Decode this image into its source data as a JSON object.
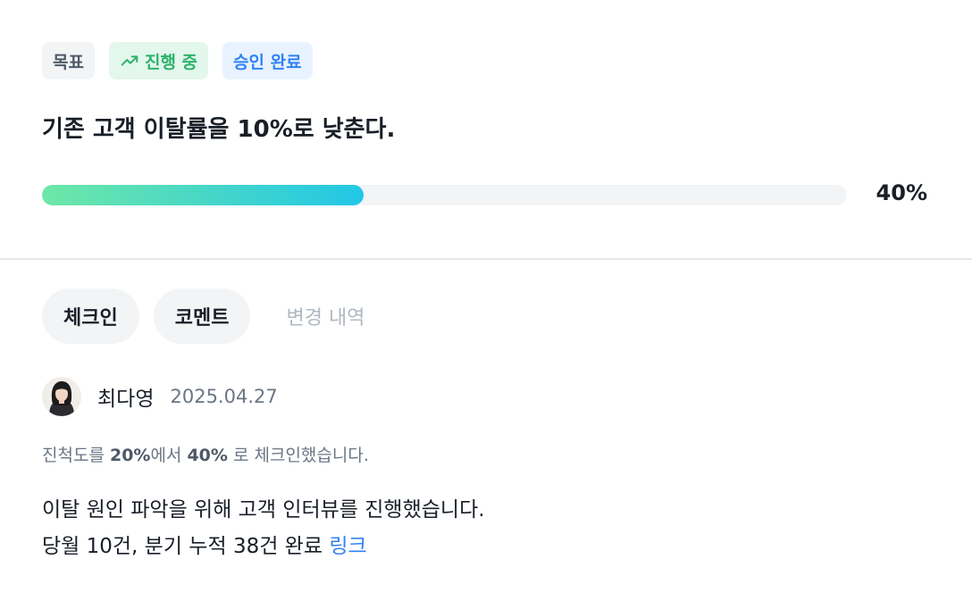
{
  "badges": {
    "category": "목표",
    "status": "진행 중",
    "status_icon": "trending-up-icon",
    "approval": "승인 완료"
  },
  "goal": {
    "title": "기존 고객 이탈률을 10%로 낮춘다.",
    "progress_value": 40,
    "progress_label": "40%"
  },
  "tabs": [
    {
      "label": "체크인"
    },
    {
      "label": "코멘트"
    },
    {
      "label": "변경 내역"
    }
  ],
  "entry": {
    "author": "최다영",
    "date": "2025.04.27",
    "checkin": {
      "prefix": "진척도를 ",
      "from": "20%",
      "middle": "에서 ",
      "to": "40%",
      "suffix": " 로 체크인했습니다."
    },
    "body_line1": "이탈 원인 파악을 위해 고객 인터뷰를 진행했습니다.",
    "body_line2": "당월 10건, 분기 누적 38건 완료 ",
    "link_text": "링크"
  },
  "colors": {
    "accent_blue": "#3182f6",
    "status_green": "#2fb26b",
    "progress_start": "#6ee7a7",
    "progress_end": "#22c7e6"
  }
}
